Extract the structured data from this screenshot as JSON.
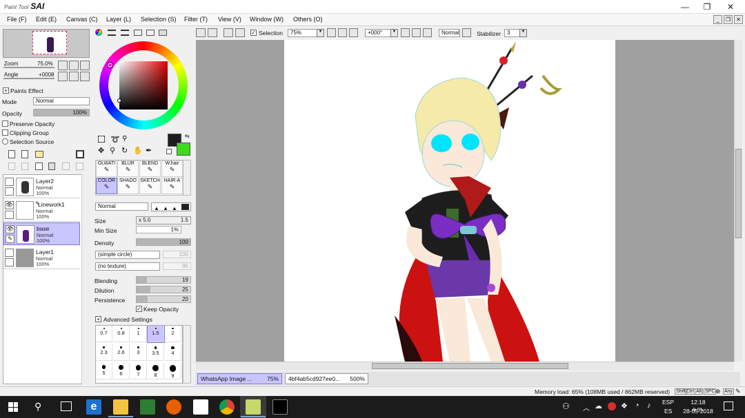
{
  "window": {
    "app_name": "SAI",
    "app_prefix": "Paint Tool"
  },
  "menubar": {
    "items": [
      "File (F)",
      "Edit (E)",
      "Canvas (C)",
      "Layer (L)",
      "Selection (S)",
      "Filter (T)",
      "View (V)",
      "Window (W)",
      "Others (O)"
    ]
  },
  "toolbar": {
    "selection_label": "Selection",
    "zoom_value": "75%",
    "rotation_value": "+000°",
    "blend_mode": "Normal",
    "stabilizer_label": "Stabilizer",
    "stabilizer_value": "3"
  },
  "navigator": {
    "zoom_label": "Zoom",
    "zoom_value": "75.0%",
    "angle_label": "Angle",
    "angle_value": "+0008"
  },
  "layer_props": {
    "paints_effect": "Paints Effect",
    "mode_label": "Mode",
    "mode_value": "Normal",
    "opacity_label": "Opacity",
    "opacity_value": "100%",
    "opacity_fraction": 1.0,
    "preserve_opacity": "Preserve Opacity",
    "clipping_group": "Clipping Group",
    "selection_source": "Selection Source"
  },
  "layers": [
    {
      "name": "Layer2",
      "mode": "Normal",
      "opacity": "100%",
      "visible": false,
      "selected": false
    },
    {
      "name": "Linework1",
      "mode": "Normal",
      "opacity": "100%",
      "visible": true,
      "selected": false
    },
    {
      "name": "base",
      "mode": "Normal",
      "opacity": "100%",
      "visible": true,
      "selected": true
    },
    {
      "name": "Layer1",
      "mode": "Normal",
      "opacity": "100%",
      "visible": false,
      "selected": false
    }
  ],
  "colors": {
    "primary": "#1e1e1e",
    "secondary": "#3ddc1a",
    "selected_layer": "#c9c5ff",
    "canvas_bg": "#a0a0a0"
  },
  "tools": {
    "row1": [
      "OLWATI",
      "BLUR",
      "BLEND",
      "W.hair"
    ],
    "row2": [
      "COLOR",
      "SHADO",
      "SKETCH",
      "HAIR-A"
    ]
  },
  "brush": {
    "mode": "Normal",
    "size_label": "Size",
    "size_mult": "x 5.0",
    "size_value": "1.5",
    "min_size_label": "Min Size",
    "min_size_value": "1%",
    "density_label": "Density",
    "density_value": "100",
    "shape": "(simple circle)",
    "shape_value": "100",
    "texture": "(no texture)",
    "texture_value": "95",
    "blending_label": "Blending",
    "blending_value": "19",
    "dilution_label": "Dilution",
    "dilution_value": "25",
    "persistence_label": "Persistence",
    "persistence_value": "20",
    "keep_opacity": "Keep Opacity",
    "advanced": "Advanced Settings",
    "sizes": [
      "0.7",
      "0.8",
      "1",
      "1.5",
      "2",
      "2.3",
      "2.6",
      "3",
      "3.5",
      "4",
      "5",
      "6",
      "7",
      "8",
      "9"
    ]
  },
  "tabs": [
    {
      "name": "WhatsApp Image ...",
      "zoom": "75%"
    },
    {
      "name": "4bf4ab5cd927ee0...",
      "zoom": "500%"
    }
  ],
  "status": {
    "memory": "Memory load: 65% (108MB used / 862MB reserved)",
    "keys": [
      "Shift",
      "Ctrl",
      "Alt",
      "SPC"
    ],
    "any": "Any"
  },
  "taskbar": {
    "lang": "ESP",
    "lang2": "ES",
    "time": "12:18 a.m.",
    "date": "28-05-2018"
  }
}
